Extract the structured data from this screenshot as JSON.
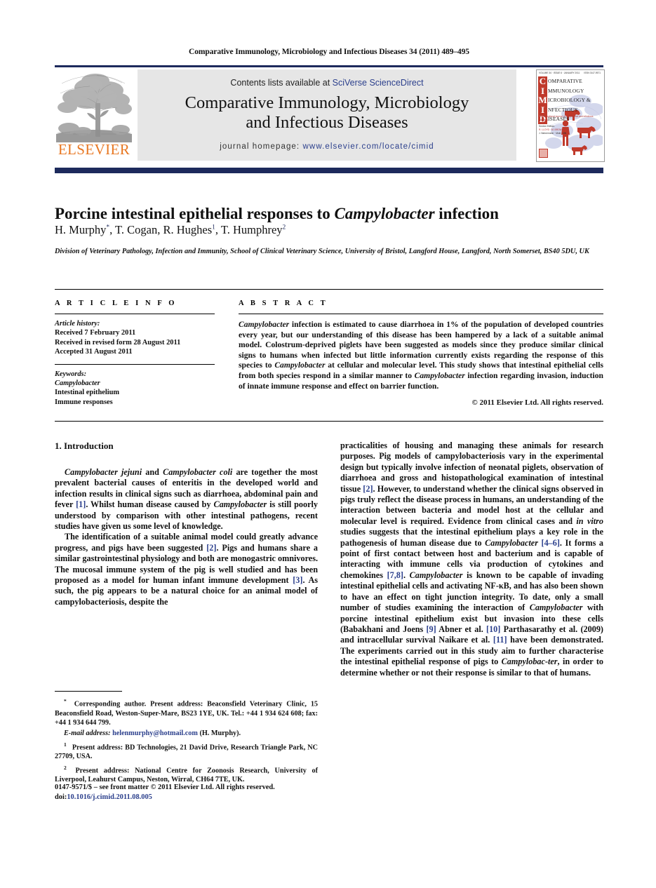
{
  "running_head": "Comparative Immunology, Microbiology and Infectious Diseases 34 (2011) 489–495",
  "masthead": {
    "contents_prefix": "Contents lists available at ",
    "contents_link": "SciVerse ScienceDirect",
    "journal_title_line1": "Comparative Immunology, Microbiology",
    "journal_title_line2": "and Infectious Diseases",
    "homepage_label": "journal homepage: ",
    "homepage_url": "www.elsevier.com/locate/cimid",
    "publisher_name": "ELSEVIER",
    "accent_orange": "#E87722",
    "accent_navy": "#1d2a5c",
    "link_blue": "#2b3f8c"
  },
  "cover": {
    "top_left": "VOLUME 34 · ISSUE 6 · JANUARY 2011",
    "top_right": "ISSN 0147-9571",
    "letters": [
      "C",
      "I",
      "M",
      "I",
      "D"
    ],
    "words": [
      "OMPARATIVE",
      "MMUNOLOGY",
      "ICROBIOLOGY &",
      "NFECTIOUS",
      "ISEASES"
    ],
    "subtitle": "An international journal of comparative and infectious diseases",
    "editors": [
      "Section Editors",
      "R. LLOYD · M. BROWN",
      "J. Bahnemann · Moki · Miti"
    ],
    "red": "#c0392b"
  },
  "title": {
    "before_italic": "Porcine intestinal epithelial responses to ",
    "italic": "Campylobacter",
    "after_italic": " infection"
  },
  "authors": [
    {
      "name": "H. Murphy",
      "mark": "*"
    },
    {
      "name": "T. Cogan",
      "mark": ""
    },
    {
      "name": "R. Hughes",
      "mark": "1"
    },
    {
      "name": "T. Humphrey",
      "mark": "2"
    }
  ],
  "affiliation": "Division of Veterinary Pathology, Infection and Immunity, School of Clinical Veterinary Science, University of Bristol, Langford House, Langford, North Somerset, BS40 5DU, UK",
  "article_info": {
    "heading": "A R T I C L E   I N F O",
    "history_label": "Article history:",
    "history": [
      "Received 7 February 2011",
      "Received in revised form 28 August 2011",
      "Accepted 31 August 2011"
    ],
    "keywords_label": "Keywords:",
    "keywords": [
      "Campylobacter",
      "Intestinal epithelium",
      "Immune responses"
    ],
    "keywords_italic_index": 0
  },
  "abstract": {
    "heading": "A B S T R A C T",
    "italic_lead": "Campylobacter",
    "text_part1": " infection is estimated to cause diarrhoea in 1% of the population of developed countries every year, but our understanding of this disease has been hampered by a lack of a suitable animal model. Colostrum-deprived piglets have been suggested as models since they produce similar clinical signs to humans when infected but little information currently exists regarding the response of this species to ",
    "italic_2": "Campylobacter",
    "text_part2": " at cellular and molecular level. This study shows that intestinal epithelial cells from both species respond in a similar manner to ",
    "italic_3": "Campylobacter",
    "text_part3": " infection regarding invasion, induction of innate immune response and effect on barrier function.",
    "copyright": "© 2011 Elsevier Ltd. All rights reserved."
  },
  "body": {
    "section_number_title": "1.  Introduction",
    "left_paragraphs": [
      {
        "runs": [
          {
            "t": "Campylobacter jejuni",
            "s": "i"
          },
          {
            "t": " and ",
            "s": "n"
          },
          {
            "t": "Campylobacter coli",
            "s": "i"
          },
          {
            "t": " are together the most prevalent bacterial causes of enteritis in the developed world and infection results in clinical signs such as diarrhoea, abdominal pain and fever ",
            "s": "n"
          },
          {
            "t": "[1]",
            "s": "r"
          },
          {
            "t": ". Whilst human disease caused by ",
            "s": "n"
          },
          {
            "t": "Campylobacter",
            "s": "i"
          },
          {
            "t": " is still poorly understood by comparison with other intestinal pathogens, recent studies have given us some level of knowledge.",
            "s": "n"
          }
        ]
      },
      {
        "runs": [
          {
            "t": "The identification of a suitable animal model could greatly advance progress, and pigs have been suggested ",
            "s": "n"
          },
          {
            "t": "[2]",
            "s": "r"
          },
          {
            "t": ". Pigs and humans share a similar gastrointestinal physiology and both are monogastric omnivores. The mucosal immune system of the pig is well studied and has been proposed as a model for human infant immune development ",
            "s": "n"
          },
          {
            "t": "[3]",
            "s": "r"
          },
          {
            "t": ". As such, the pig appears to be a natural choice for an animal model of campylobacteriosis, despite the",
            "s": "n"
          }
        ]
      }
    ],
    "right_paragraphs": [
      {
        "runs": [
          {
            "t": "practicalities of housing and managing these animals for research purposes. Pig models of campylobacteriosis vary in the experimental design but typically involve infection of neonatal piglets, observation of diarrhoea and gross and histopathological examination of intestinal tissue ",
            "s": "n"
          },
          {
            "t": "[2]",
            "s": "r"
          },
          {
            "t": ". However, to understand whether the clinical signs observed in pigs truly reflect the disease process in humans, an understanding of the interaction between bacteria and model host at the cellular and molecular level is required. Evidence from clinical cases and ",
            "s": "n"
          },
          {
            "t": "in vitro",
            "s": "i"
          },
          {
            "t": " studies suggests that the intestinal epithelium plays a key role in the pathogenesis of human disease due to ",
            "s": "n"
          },
          {
            "t": "Campylobacter",
            "s": "i"
          },
          {
            "t": " ",
            "s": "n"
          },
          {
            "t": "[4–6]",
            "s": "r"
          },
          {
            "t": ". It forms a point of first contact between host and bacterium and is capable of interacting with immune cells via production of cytokines and chemokines ",
            "s": "n"
          },
          {
            "t": "[7,8]",
            "s": "r"
          },
          {
            "t": ". ",
            "s": "n"
          },
          {
            "t": "Campylobacter",
            "s": "i"
          },
          {
            "t": " is known to be capable of invading intestinal epithelial cells and activating NF-κB, and has also been shown to have an effect on tight junction integrity. To date, only a small number of studies examining the interaction of ",
            "s": "n"
          },
          {
            "t": "Campylobacter",
            "s": "i"
          },
          {
            "t": " with porcine intestinal epithelium exist but invasion into these cells (Babakhani and Joens ",
            "s": "n"
          },
          {
            "t": "[9]",
            "s": "r"
          },
          {
            "t": " Abner et al. ",
            "s": "n"
          },
          {
            "t": "[10]",
            "s": "r"
          },
          {
            "t": " Parthasarathy et al. (2009) and intracellular survival Naikare et al. ",
            "s": "n"
          },
          {
            "t": "[11]",
            "s": "r"
          },
          {
            "t": " have been demonstrated. The experiments carried out in this study aim to further characterise the intestinal epithelial response of pigs to ",
            "s": "n"
          },
          {
            "t": "Campylobac-",
            "s": "i"
          },
          {
            "t": "",
            "s": "n"
          },
          {
            "t": "ter",
            "s": "i"
          },
          {
            "t": ", in order to determine whether or not their response is similar to that of humans.",
            "s": "n"
          }
        ]
      }
    ]
  },
  "footnotes": [
    {
      "mark": "*",
      "runs": [
        {
          "t": "Corresponding author. Present address: Beaconsfield Veterinary Clinic, 15 Beaconsfield Road, Weston-Super-Mare, BS23 1YE, UK. Tel.: +44 1 934 624 608; fax: +44 1 934 644 799.",
          "s": "n"
        }
      ]
    },
    {
      "mark": "",
      "indent": true,
      "runs": [
        {
          "t": "E-mail address:",
          "s": "i"
        },
        {
          "t": " ",
          "s": "n"
        },
        {
          "t": "helenmurphy@hotmail.com",
          "s": "m"
        },
        {
          "t": " (H. Murphy).",
          "s": "n"
        }
      ]
    },
    {
      "mark": "1",
      "runs": [
        {
          "t": "Present address: BD Technologies, 21 David Drive, Research Triangle Park, NC 27709, USA.",
          "s": "n"
        }
      ]
    },
    {
      "mark": "2",
      "runs": [
        {
          "t": "Present address: National Centre for Zoonosis Research, University of Liverpool, Leahurst Campus, Neston, Wirral, CH64 7TE, UK.",
          "s": "n"
        }
      ]
    }
  ],
  "imprint": {
    "line1": "0147-9571/$ – see front matter © 2011 Elsevier Ltd. All rights reserved.",
    "doi_label": "doi:",
    "doi_value": "10.1016/j.cimid.2011.08.005"
  }
}
